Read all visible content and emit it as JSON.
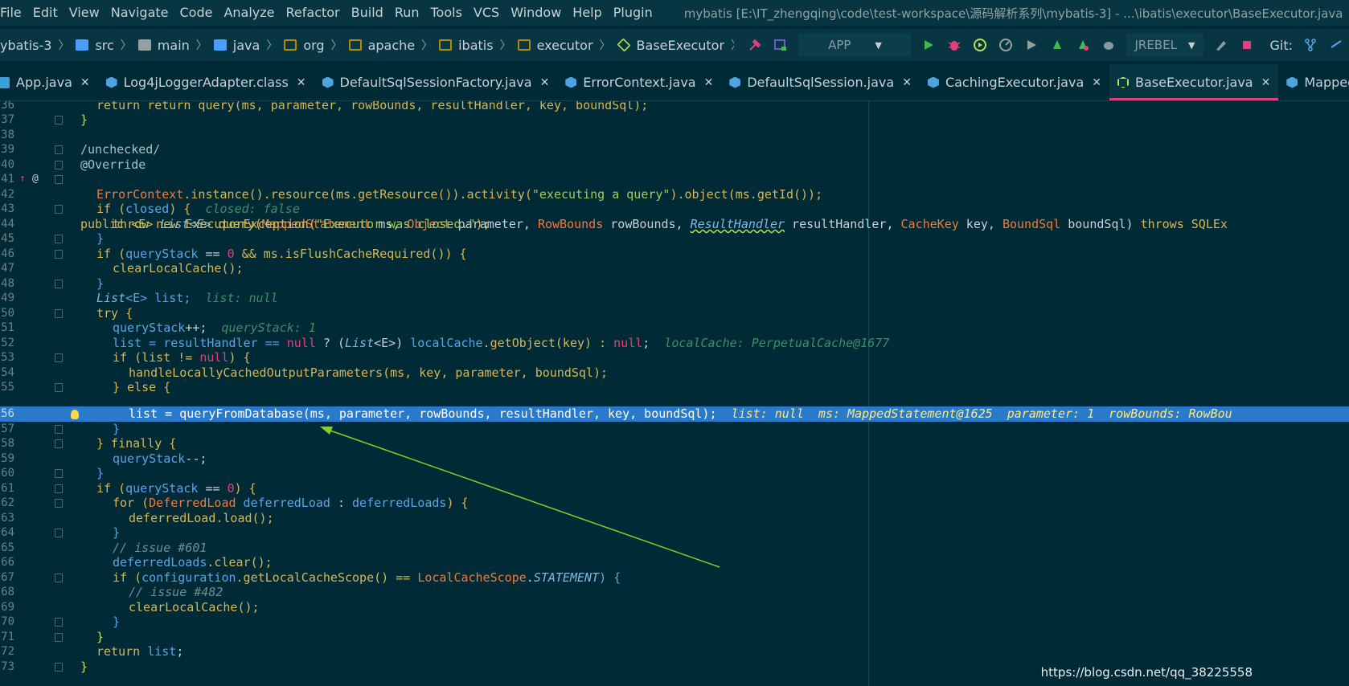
{
  "menu": [
    "File",
    "Edit",
    "View",
    "Navigate",
    "Code",
    "Analyze",
    "Refactor",
    "Build",
    "Run",
    "Tools",
    "VCS",
    "Window",
    "Help",
    "Plugin"
  ],
  "window_title": "mybatis [E:\\IT_zhengqing\\code\\test-workspace\\源码解析系列\\mybatis-3] - ...\\ibatis\\executor\\BaseExecutor.java",
  "breadcrumb": [
    "ybatis-3",
    "src",
    "main",
    "java",
    "org",
    "apache",
    "ibatis",
    "executor",
    "BaseExecutor"
  ],
  "toolbar": {
    "run_config": "APP",
    "jrebel": "JREBEL",
    "git_label": "Git:"
  },
  "tabs": [
    {
      "label": "App.java",
      "active": false
    },
    {
      "label": "Log4jLoggerAdapter.class",
      "active": false
    },
    {
      "label": "DefaultSqlSessionFactory.java",
      "active": false
    },
    {
      "label": "ErrorContext.java",
      "active": false
    },
    {
      "label": "DefaultSqlSession.java",
      "active": false
    },
    {
      "label": "CachingExecutor.java",
      "active": false
    },
    {
      "label": "BaseExecutor.java",
      "active": true
    },
    {
      "label": "MappedStatement.java",
      "active": false
    }
  ],
  "line_numbers": [
    "36",
    "37",
    "38",
    "39",
    "40",
    "41",
    "42",
    "43",
    "44",
    "45",
    "46",
    "47",
    "48",
    "49",
    "50",
    "51",
    "52",
    "53",
    "54",
    "55",
    "56",
    "57",
    "58",
    "59",
    "60",
    "61",
    "62",
    "63",
    "64",
    "65",
    "66",
    "67",
    "68",
    "69",
    "70",
    "71",
    "72",
    "73"
  ],
  "code": {
    "l36": "return query(ms, parameter, rowBounds, resultHandler, key, boundSql);",
    "l37": "}",
    "l39": "/unchecked/",
    "l40": "@Override",
    "l41_a": "public ",
    "l41_b": "<E> ",
    "l41_c": "List<E> ",
    "l41_d": "query(",
    "l41_e": "MappedStatement",
    "l41_f": " ms, ",
    "l41_g": "Object",
    "l41_h": " parameter, ",
    "l41_i": "RowBounds",
    "l41_j": " rowBounds, ",
    "l41_k": "ResultHandler",
    "l41_l": " resultHandler, ",
    "l41_m": "CacheKey",
    "l41_n": " key, ",
    "l41_o": "BoundSql",
    "l41_p": " boundSql) ",
    "l41_q": "throws SQLEx",
    "l42_a": "ErrorContext",
    "l42_b": ".instance().resource(ms.getResource()).activity(",
    "l42_c": "\"executing a query\"",
    "l42_d": ").object(ms.getId());",
    "l43_a": "if (",
    "l43_b": "closed",
    "l43_c": ") {  ",
    "l43_hint": "closed: false",
    "l44_a": "throw new ",
    "l44_b": "ExecutorException(",
    "l44_c": "\"Executor was closed.\"",
    "l44_d": ");",
    "l46_a": "if (",
    "l46_b": "queryStack",
    "l46_c": " == ",
    "l46_d": "0",
    "l46_e": " && ms.isFlushCacheRequired()) {",
    "l47": "clearLocalCache();",
    "l49_a": "List",
    "l49_b": "<E> list;  ",
    "l49_hint": "list: null",
    "l50": "try {",
    "l51_a": "queryStack",
    "l51_b": "++;  ",
    "l51_hint": "queryStack: 1",
    "l52_a": "list = resultHandler == ",
    "l52_b": "null",
    "l52_c": " ? (",
    "l52_d": "List",
    "l52_e": "<E>) ",
    "l52_f": "localCache",
    "l52_g": ".getObject(key) : ",
    "l52_h": "null",
    "l52_i": ";  ",
    "l52_hint": "localCache: PerpetualCache@1677",
    "l53_a": "if (list != ",
    "l53_b": "null",
    "l53_c": ") {",
    "l54": "handleLocallyCachedOutputParameters(ms, key, parameter, boundSql);",
    "l55": "} else {",
    "l56": "list = queryFromDatabase(ms, parameter, rowBounds, resultHandler, key, boundSql);",
    "l56_hint": "list: null  ms: MappedStatement@1625  parameter: 1  rowBounds: RowBou",
    "l58": "} finally {",
    "l59_a": "queryStack",
    "l59_b": "--;",
    "l61_a": "if (",
    "l61_b": "queryStack",
    "l61_c": " == ",
    "l61_d": "0",
    "l61_e": ") {",
    "l62_a": "for (",
    "l62_b": "DeferredLoad",
    "l62_c": " deferredLoad",
    "l62_d": " : ",
    "l62_e": "deferredLoads",
    "l62_f": ") {",
    "l63": "deferredLoad.load();",
    "l65": "// issue #601",
    "l66_a": "deferredLoads",
    "l66_b": ".clear();",
    "l67_a": "if (",
    "l67_b": "configuration",
    "l67_c": ".getLocalCacheScope() == ",
    "l67_d": "LocalCacheScope",
    "l67_e": ".",
    "l67_f": "STATEMENT",
    "l67_g": ") {",
    "l68": "// issue #482",
    "l69": "clearLocalCache();",
    "l72_a": "return ",
    "l72_b": "list",
    "l72_c": ";"
  },
  "watermark": "https://blog.csdn.net/qq_38225558",
  "colors": {
    "background": "#002b36",
    "current_line": "#2a7acc",
    "active_tab_underline": "#e0407a",
    "annotation_arrow": "#7ed321"
  }
}
